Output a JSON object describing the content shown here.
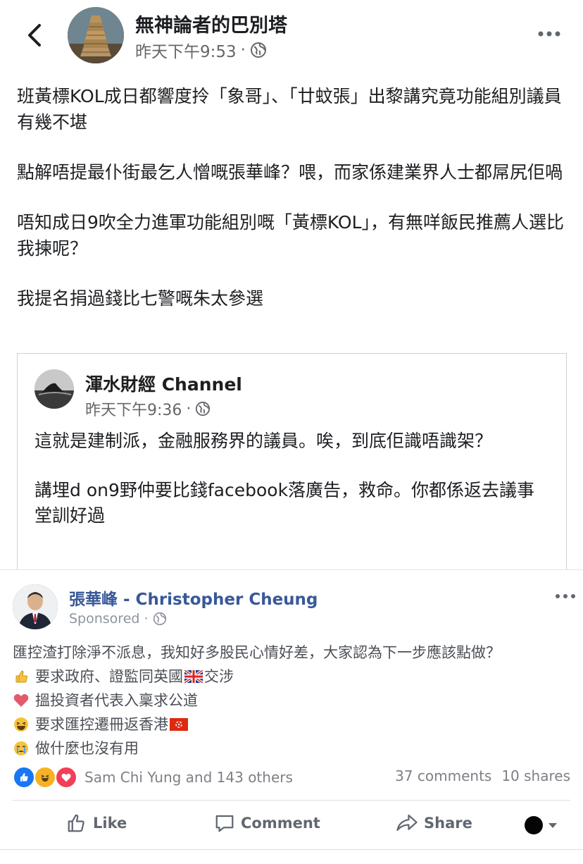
{
  "header": {
    "page_name": "無神論者的巴別塔",
    "timestamp": "昨天下午9:53",
    "separator": "·"
  },
  "post": {
    "paragraphs": [
      "班黃標KOL成日都響度拎「象哥」、「廿蚊張」出黎講究竟功能組別議員有幾不堪",
      "點解唔提最仆街最乞人憎嘅張華峰？喂，而家係建業界人士都屌尻佢喎",
      "唔知成日9吹全力進軍功能組別嘅「黃標KOL」，有無咩飯民推薦人選比我揀呢？",
      "我提名捐過錢比七警嘅朱太參選"
    ]
  },
  "shared": {
    "page_name": "渾水財經 Channel",
    "timestamp": "昨天下午9:36",
    "separator": "·",
    "paragraphs": [
      "這就是建制派，金融服務界的議員。唉，到底佢識唔識架？",
      "講埋d on9野仲要比錢facebook落廣告，救命。你都係返去議事堂訓好過"
    ]
  },
  "ad": {
    "name": "張華峰 - Christopher Cheung",
    "sponsored": "Sponsored",
    "separator": "·",
    "intro": "匯控渣打除淨不派息，我知好多股民心情好差，大家認為下一步應該點做？",
    "options": [
      {
        "icon": "thumbs-up-icon",
        "text": "要求政府、證監同英國",
        "flag": "uk-flag-icon",
        "after": "交涉"
      },
      {
        "icon": "heart-icon",
        "text": "搵投資者代表入稟求公道",
        "flag": "",
        "after": ""
      },
      {
        "icon": "laughing-face-icon",
        "text": "要求匯控遷冊返香港",
        "flag": "hk-flag-icon",
        "after": ""
      },
      {
        "icon": "crying-face-icon",
        "text": "做什麼也沒有用",
        "flag": "",
        "after": ""
      }
    ],
    "reactions_text": "Sam Chi Yung and 143 others",
    "comments": "37 comments",
    "shares": "10 shares",
    "actions": {
      "like": "Like",
      "comment": "Comment",
      "share": "Share"
    }
  },
  "colors": {
    "text": "#1c1e21",
    "meta": "#65676b",
    "ad_name": "#385898",
    "like_blue": "#1877f2",
    "haha_yellow": "#f7b125",
    "love_red": "#f33e58"
  }
}
